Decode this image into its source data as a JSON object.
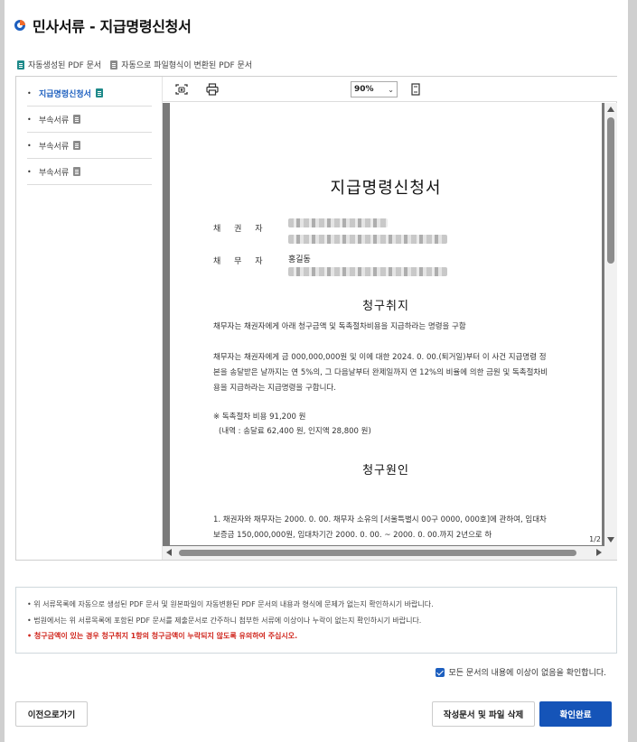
{
  "window": {
    "title": "민사서류 - 지급명령신청서"
  },
  "legend": {
    "auto": "자동생성된 PDF 문서",
    "converted": "자동으로 파일형식이 변환된 PDF 문서"
  },
  "sidebar": {
    "items": [
      {
        "label": "지급명령신청서",
        "active": true,
        "icon": "auto-pdf-icon"
      },
      {
        "label": "부속서류",
        "active": false,
        "icon": "converted-pdf-icon"
      },
      {
        "label": "부속서류",
        "active": false,
        "icon": "converted-pdf-icon"
      },
      {
        "label": "부속서류",
        "active": false,
        "icon": "converted-pdf-icon"
      }
    ]
  },
  "viewer": {
    "zoom": "90%",
    "page_indicator": "1/2",
    "tools": [
      "snapshot-icon",
      "print-icon",
      "fit-page-icon"
    ]
  },
  "document": {
    "title": "지급명령신청서",
    "creditor_label": "채 권 자",
    "debtor_label": "채 무 자",
    "debtor_name": "홍길동",
    "section1_title": "청구취지",
    "para1": "채무자는 채권자에게 아래 청구금액 및 독촉절차비용을 지급하라는 명령을 구함",
    "para2": "채무자는 채권자에게 금 000,000,000원 및 이에 대한 2024. 0. 00.(퇴거일)부터 이 사건 지급명령 정본을 송달받은 날까지는 연 5%의, 그 다음날부터 완제일까지 연 12%의 비율에 의한 금원 및 독촉절차비용을 지급하라는 지급명령을 구합니다.",
    "cost_line": "※ 독촉절차 비용 91,200 원",
    "cost_detail": "(내역 : 송달료 62,400 원, 인지액 28,800 원)",
    "section2_title": "청구원인",
    "para3": "1. 채권자와 채무자는 2000. 0. 00. 채무자 소유의 [서울특별시 00구 0000, 000호]에 관하여, 임대차보증금 150,000,000원, 임대차기간 2000. 0. 00. ~ 2000. 0. 00.까지 2년으로 하"
  },
  "notice": {
    "line1": "위 서류목록에 자동으로 생성된 PDF 문서 및 원본파일이 자동변환된 PDF 문서의 내용과 형식에 문제가 없는지 확인하시기 바랍니다.",
    "line2": "법원에서는 위 서류목록에 포함된 PDF 문서를 제출문서로 간주하니 첨부한 서류에 이상이나 누락이 없는지 확인하시기 바랍니다.",
    "line3": "청구금액이 있는 경우 청구취지 1항의 청구금액이 누락되지 않도록 유의하여 주십시오."
  },
  "confirm_label": "모든 문서의 내용에 이상이 없음을 확인합니다.",
  "buttons": {
    "prev": "이전으로가기",
    "delete": "작성문서 및 파일 삭제",
    "ok": "확인완료"
  },
  "colors": {
    "primary": "#1554b8",
    "warning": "#d0281f",
    "auto_pdf": "#1f8a8a",
    "converted_pdf": "#8a8a8a"
  }
}
